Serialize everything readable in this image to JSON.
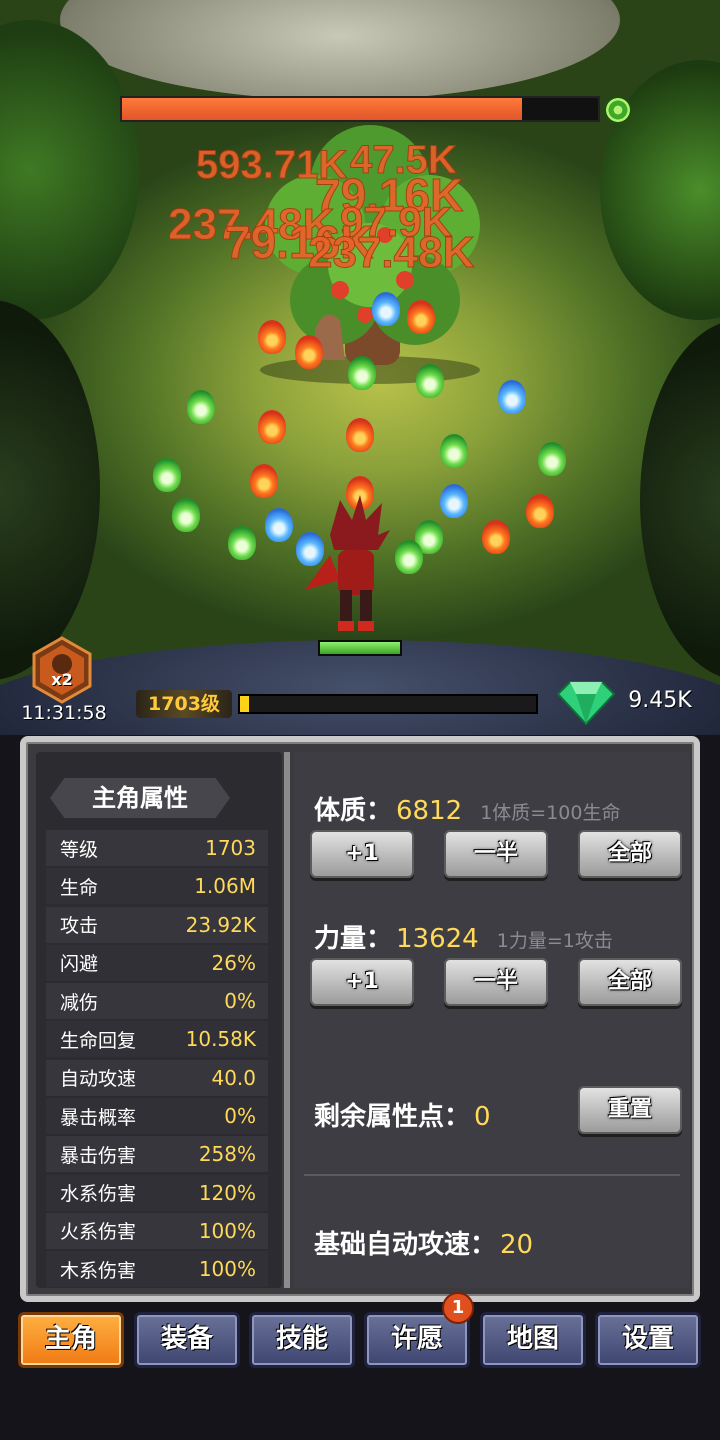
{
  "battle": {
    "boss_hp_fraction": 0.84,
    "damage_numbers": [
      "593.71K",
      "47.5K",
      "79.16K",
      "237.48K",
      "97.9K",
      "79.16K",
      "237.48K"
    ],
    "speed_multiplier": "x2",
    "clock": "11:31:58",
    "level_tag": "1703级",
    "exp_fraction": 0.03,
    "gems": "9.45K"
  },
  "stats_panel": {
    "title": "主角属性",
    "rows": [
      {
        "name": "等级",
        "value": "1703"
      },
      {
        "name": "生命",
        "value": "1.06M"
      },
      {
        "name": "攻击",
        "value": "23.92K"
      },
      {
        "name": "闪避",
        "value": "26%"
      },
      {
        "name": "减伤",
        "value": "0%"
      },
      {
        "name": "生命回复",
        "value": "10.58K"
      },
      {
        "name": "自动攻速",
        "value": "40.0"
      },
      {
        "name": "暴击概率",
        "value": "0%"
      },
      {
        "name": "暴击伤害",
        "value": "258%"
      },
      {
        "name": "水系伤害",
        "value": "120%"
      },
      {
        "name": "火系伤害",
        "value": "100%"
      },
      {
        "name": "木系伤害",
        "value": "100%"
      }
    ]
  },
  "attributes": {
    "constitution": {
      "label": "体质：",
      "value": "6812",
      "note": "1体质=100生命"
    },
    "strength": {
      "label": "力量：",
      "value": "13624",
      "note": "1力量=1攻击"
    },
    "buttons": {
      "plus_one": "+1",
      "half": "一半",
      "all": "全部"
    },
    "remaining": {
      "label": "剩余属性点：",
      "value": "0"
    },
    "reset_label": "重置",
    "base_speed": {
      "label": "基础自动攻速：",
      "value": "20"
    }
  },
  "tabs": [
    {
      "label": "主角"
    },
    {
      "label": "装备"
    },
    {
      "label": "技能"
    },
    {
      "label": "许愿"
    },
    {
      "label": "地图"
    },
    {
      "label": "设置"
    }
  ],
  "wish_badge": "1",
  "colors": {
    "accent": "#f07a14",
    "value_yellow": "#ffd95a",
    "damage": "#e8632a"
  }
}
